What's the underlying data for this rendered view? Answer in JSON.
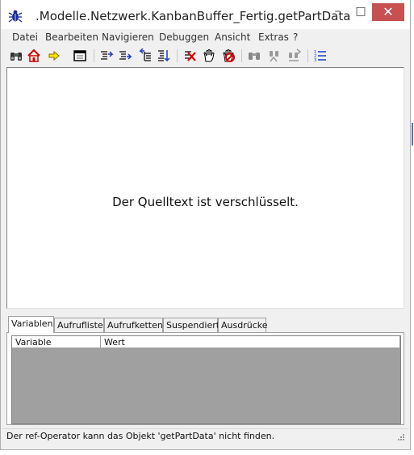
{
  "window": {
    "title": ".Modelle.Netzwerk.KanbanBuffer_Fertig.getPartData",
    "controls": {
      "minimize": "–",
      "maximize": "□",
      "close": "✕"
    }
  },
  "menu": [
    "Datei",
    "Bearbeiten",
    "Navigieren",
    "Debuggen",
    "Ansicht",
    "Extras",
    "?"
  ],
  "toolbar": {
    "icons": [
      "binoculars-icon",
      "home-icon",
      "arrow-right-icon",
      "window-icon",
      "step-into-icon",
      "step-over-icon",
      "step-out-icon",
      "step-down-icon",
      "delete-breakpoint-icon",
      "hand-icon",
      "stop-hand-icon",
      "find-icon",
      "find-next-icon",
      "replace-icon",
      "numbered-list-icon"
    ]
  },
  "source": {
    "message": "Der Quelltext ist verschlüsselt."
  },
  "tabs": [
    "Variablen",
    "Aufrufliste",
    "Aufrufketten",
    "Suspendiert",
    "Ausdrücke"
  ],
  "active_tab": "Variablen",
  "variables_table": {
    "columns": [
      "Variable",
      "Wert"
    ],
    "rows": []
  },
  "status": {
    "text": "Der ref-Operator kann das Objekt 'getPartData' nicht finden."
  }
}
